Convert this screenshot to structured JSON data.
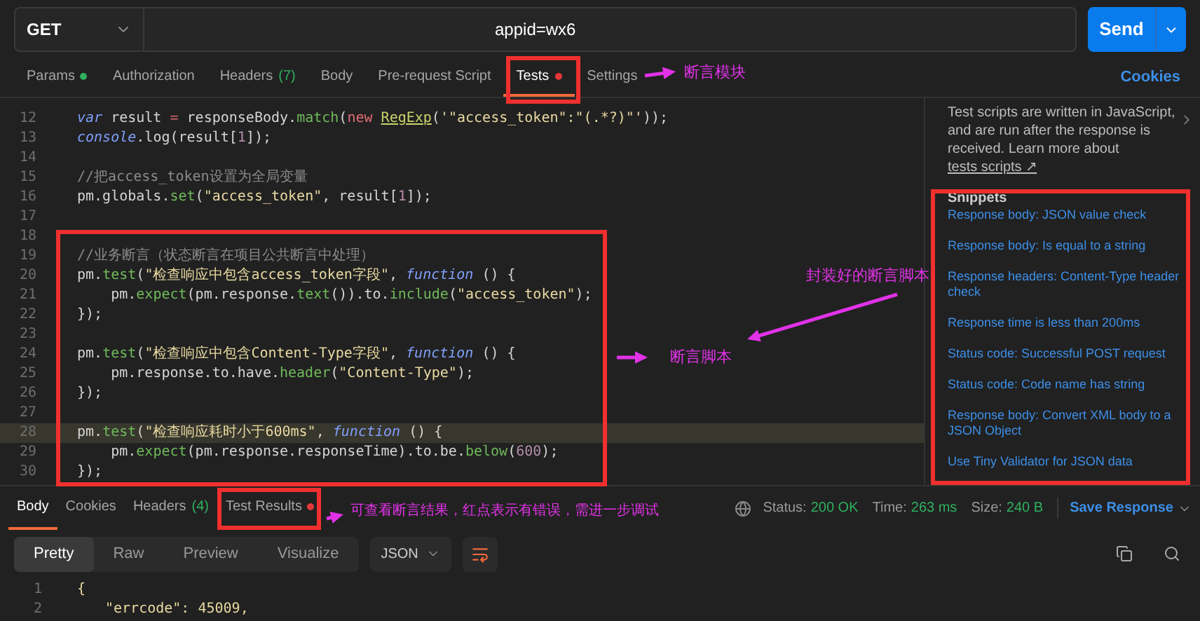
{
  "request": {
    "method": "GET",
    "url_visible": "appid=wx6",
    "send": "Send"
  },
  "tabs": [
    {
      "label": "Params",
      "color": "#2fb160",
      "selected": false
    },
    {
      "label": "Authorization",
      "selected": false
    },
    {
      "label": "Headers",
      "count": "(7)",
      "selected": false
    },
    {
      "label": "Body",
      "selected": false
    },
    {
      "label": "Pre-request Script",
      "selected": false
    },
    {
      "label": "Tests",
      "color": "#e5373a",
      "selected": true
    },
    {
      "label": "Settings",
      "selected": false
    }
  ],
  "cookies": "Cookies",
  "editor": {
    "lines": [
      {
        "n": "12",
        "current": false,
        "tokens": [
          {
            "kind": "italic",
            "text": "var"
          },
          {
            "kind": "plain",
            "text": " result "
          },
          {
            "kind": "keyword",
            "text": "="
          },
          {
            "kind": "plain",
            "text": " responseBody."
          },
          {
            "kind": "fn",
            "text": "match"
          },
          {
            "kind": "plain",
            "text": "("
          },
          {
            "kind": "keyword",
            "text": "new "
          },
          {
            "kind": "class",
            "text": "RegExp"
          },
          {
            "kind": "plain",
            "text": "("
          },
          {
            "kind": "string",
            "text": "'\"access_token\":\"(.*?)\"'"
          },
          {
            "kind": "plain",
            "text": "));"
          }
        ]
      },
      {
        "n": "13",
        "current": false,
        "tokens": [
          {
            "kind": "italic",
            "text": "console"
          },
          {
            "kind": "plain",
            "text": ".log(result["
          },
          {
            "kind": "number",
            "text": "1"
          },
          {
            "kind": "plain",
            "text": "]);"
          }
        ]
      },
      {
        "n": "14",
        "current": false
      },
      {
        "n": "15",
        "current": false,
        "tokens": [
          {
            "kind": "comment",
            "text": "//把access_token设置为全局变量"
          }
        ]
      },
      {
        "n": "16",
        "current": false,
        "tokens": [
          {
            "kind": "plain",
            "text": "pm.globals."
          },
          {
            "kind": "fn",
            "text": "set"
          },
          {
            "kind": "plain",
            "text": "("
          },
          {
            "kind": "string",
            "text": "\"access_token\""
          },
          {
            "kind": "plain",
            "text": ", result["
          },
          {
            "kind": "number",
            "text": "1"
          },
          {
            "kind": "plain",
            "text": "]);"
          }
        ]
      },
      {
        "n": "17",
        "current": false
      },
      {
        "n": "18",
        "current": false
      },
      {
        "n": "19",
        "current": false,
        "tokens": [
          {
            "kind": "comment",
            "text": "//业务断言（状态断言在项目公共断言中处理）"
          }
        ]
      },
      {
        "n": "20",
        "current": false,
        "tokens": [
          {
            "kind": "plain",
            "text": "pm."
          },
          {
            "kind": "fn",
            "text": "test"
          },
          {
            "kind": "plain",
            "text": "("
          },
          {
            "kind": "string",
            "text": "\"检查响应中包含access_token字段\""
          },
          {
            "kind": "plain",
            "text": ", "
          },
          {
            "kind": "italic",
            "text": "function"
          },
          {
            "kind": "plain",
            "text": " () {"
          }
        ]
      },
      {
        "n": "21",
        "current": false,
        "tokens": [
          {
            "kind": "plain",
            "text": "    pm."
          },
          {
            "kind": "fn",
            "text": "expect"
          },
          {
            "kind": "plain",
            "text": "(pm.response."
          },
          {
            "kind": "fn",
            "text": "text"
          },
          {
            "kind": "plain",
            "text": "()).to."
          },
          {
            "kind": "fn",
            "text": "include"
          },
          {
            "kind": "plain",
            "text": "("
          },
          {
            "kind": "string",
            "text": "\"access_token\""
          },
          {
            "kind": "plain",
            "text": ");"
          }
        ]
      },
      {
        "n": "22",
        "current": false,
        "tokens": [
          {
            "kind": "plain",
            "text": "});"
          }
        ]
      },
      {
        "n": "23",
        "current": false
      },
      {
        "n": "24",
        "current": false,
        "tokens": [
          {
            "kind": "plain",
            "text": "pm."
          },
          {
            "kind": "fn",
            "text": "test"
          },
          {
            "kind": "plain",
            "text": "("
          },
          {
            "kind": "string",
            "text": "\"检查响应中包含Content-Type字段\""
          },
          {
            "kind": "plain",
            "text": ", "
          },
          {
            "kind": "italic",
            "text": "function"
          },
          {
            "kind": "plain",
            "text": " () {"
          }
        ]
      },
      {
        "n": "25",
        "current": false,
        "tokens": [
          {
            "kind": "plain",
            "text": "    pm.response.to.have."
          },
          {
            "kind": "fn",
            "text": "header"
          },
          {
            "kind": "plain",
            "text": "("
          },
          {
            "kind": "string",
            "text": "\"Content-Type\""
          },
          {
            "kind": "plain",
            "text": ");"
          }
        ]
      },
      {
        "n": "26",
        "current": false,
        "tokens": [
          {
            "kind": "plain",
            "text": "});"
          }
        ]
      },
      {
        "n": "27",
        "current": false
      },
      {
        "n": "28",
        "current": true,
        "tokens": [
          {
            "kind": "plain",
            "text": "pm."
          },
          {
            "kind": "fn",
            "text": "test"
          },
          {
            "kind": "plain",
            "text": "("
          },
          {
            "kind": "string",
            "text": "\"检查响应耗时小于600ms\""
          },
          {
            "kind": "plain",
            "text": ", "
          },
          {
            "kind": "italic",
            "text": "function"
          },
          {
            "kind": "plain",
            "text": " () {"
          }
        ]
      },
      {
        "n": "29",
        "current": false,
        "tokens": [
          {
            "kind": "plain",
            "text": "    pm."
          },
          {
            "kind": "fn",
            "text": "expect"
          },
          {
            "kind": "plain",
            "text": "(pm.response.responseTime).to.be."
          },
          {
            "kind": "fn",
            "text": "below"
          },
          {
            "kind": "plain",
            "text": "("
          },
          {
            "kind": "number",
            "text": "600"
          },
          {
            "kind": "plain",
            "text": ");"
          }
        ]
      },
      {
        "n": "30",
        "current": false,
        "tokens": [
          {
            "kind": "plain",
            "text": "});"
          }
        ]
      }
    ]
  },
  "help": {
    "text": "Test scripts are written in JavaScript, and are run after the response is received. Learn more about",
    "link": "tests scripts ↗"
  },
  "snippets": {
    "title": "Snippets",
    "items": [
      "Response body: JSON value check",
      "Response body: Is equal to a string",
      "Response headers: Content-Type header check",
      "Response time is less than 200ms",
      "Status code: Successful POST request",
      "Status code: Code name has string",
      "Response body: Convert XML body to a JSON Object",
      "Use Tiny Validator for JSON data"
    ]
  },
  "response_tabs": [
    {
      "label": "Body",
      "selected": true
    },
    {
      "label": "Cookies",
      "selected": false
    },
    {
      "label": "Headers",
      "count": "(4)",
      "selected": false
    },
    {
      "label": "Test Results",
      "color": "#e5373a",
      "selected": false
    }
  ],
  "status": [
    {
      "label": "Status:",
      "value": "200 OK"
    },
    {
      "label": "Time:",
      "value": "263 ms"
    },
    {
      "label": "Size:",
      "value": "240 B"
    }
  ],
  "save_response": "Save Response",
  "view_modes": [
    {
      "label": "Pretty",
      "selected": true
    },
    {
      "label": "Raw",
      "selected": false
    },
    {
      "label": "Preview",
      "selected": false
    },
    {
      "label": "Visualize",
      "selected": false
    }
  ],
  "format": "JSON",
  "response_lines": [
    {
      "n": "1",
      "text": "{"
    },
    {
      "n": "2",
      "text": "\"errcode\": 45009,"
    }
  ],
  "annotations": [
    "断言模块",
    "封装好的断言脚本",
    "断言脚本",
    "可查看断言结果，红点表示有错误，需进一步调试"
  ]
}
